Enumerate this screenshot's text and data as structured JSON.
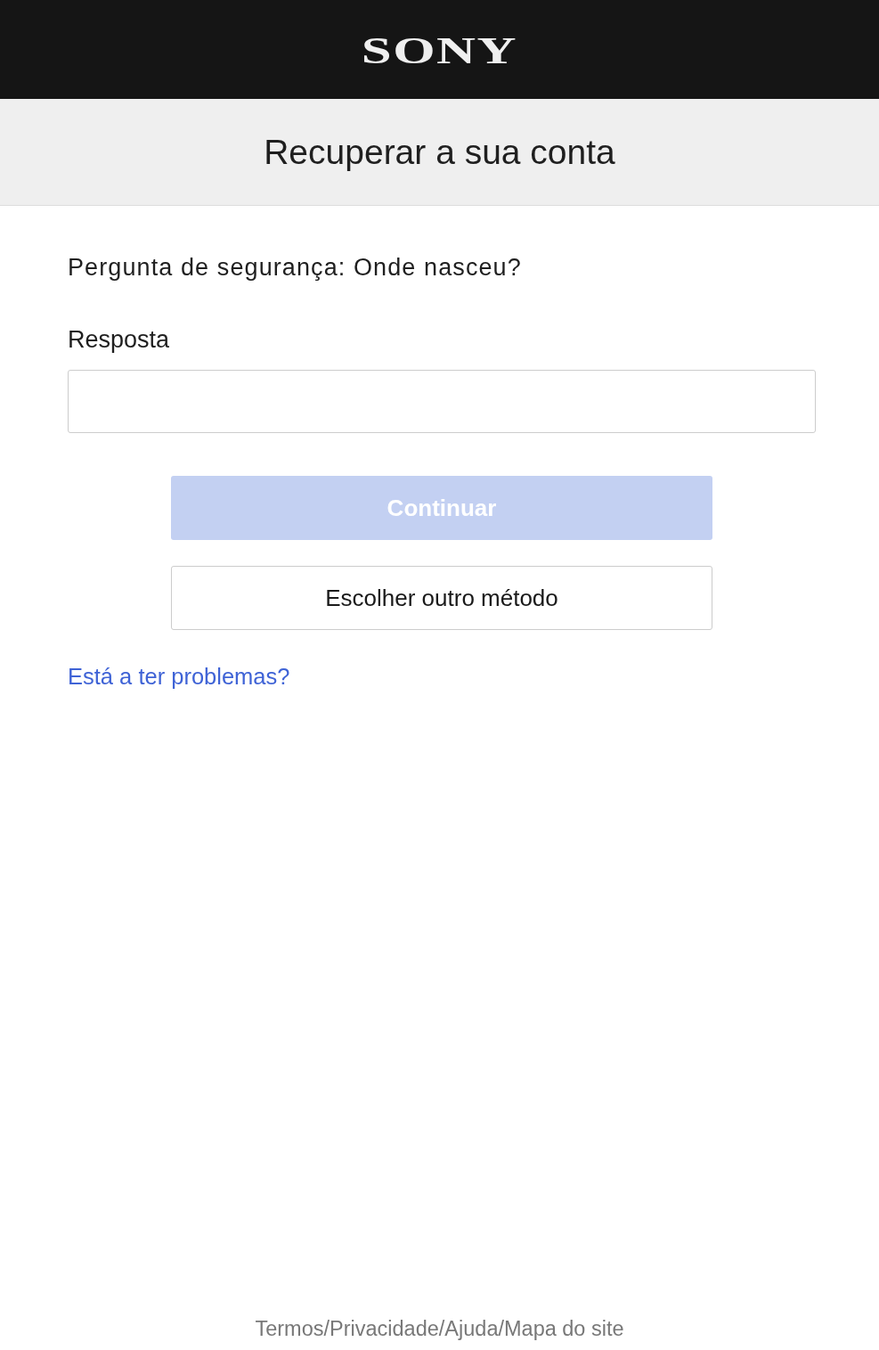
{
  "header": {
    "logo": "SONY"
  },
  "title": "Recuperar a sua conta",
  "question": "Pergunta de segurança: Onde nasceu?",
  "answer_field": {
    "label": "Resposta"
  },
  "buttons": [
    {
      "kind": "primary",
      "label": "Continuar",
      "disabled": true
    },
    {
      "kind": "secondary",
      "label": "Escolher outro método",
      "disabled": false
    }
  ],
  "help_link": "Está a ter problemas?",
  "footer": {
    "links": [
      "Termos",
      "Privacidade",
      "Ajuda",
      "Mapa do site"
    ],
    "separators": [
      "/",
      "/",
      "/"
    ]
  }
}
